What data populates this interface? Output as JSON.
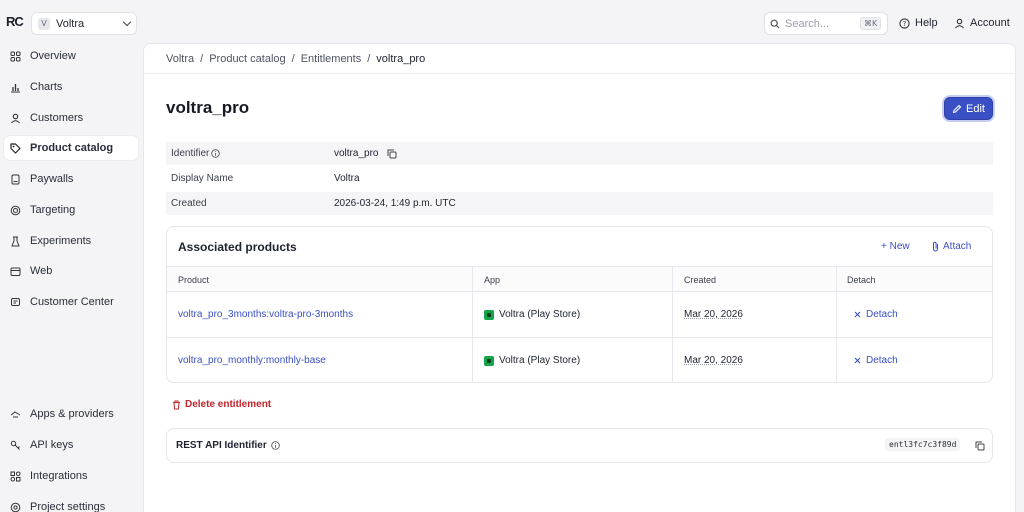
{
  "app": {
    "logo_text": "RC",
    "project_initial": "V",
    "project_name": "Voltra"
  },
  "topbar": {
    "search_placeholder": "Search...",
    "search_shortcut": "⌘K",
    "help_label": "Help",
    "account_label": "Account"
  },
  "sidebar": {
    "items": [
      {
        "label": "Overview",
        "icon": "grid-icon"
      },
      {
        "label": "Charts",
        "icon": "chart-icon"
      },
      {
        "label": "Customers",
        "icon": "user-icon"
      },
      {
        "label": "Product catalog",
        "icon": "tag-icon",
        "active": true
      },
      {
        "label": "Paywalls",
        "icon": "paywall-icon"
      },
      {
        "label": "Targeting",
        "icon": "target-icon"
      },
      {
        "label": "Experiments",
        "icon": "flask-icon"
      },
      {
        "label": "Web",
        "icon": "browser-icon"
      },
      {
        "label": "Customer Center",
        "icon": "support-icon"
      }
    ],
    "bottom_items": [
      {
        "label": "Apps & providers",
        "icon": "apps-icon"
      },
      {
        "label": "API keys",
        "icon": "key-icon"
      },
      {
        "label": "Integrations",
        "icon": "integrations-icon"
      },
      {
        "label": "Project settings",
        "icon": "settings-icon"
      }
    ]
  },
  "breadcrumb": [
    "Voltra",
    "Product catalog",
    "Entitlements",
    "voltra_pro"
  ],
  "breadcrumb_separator": "/",
  "page": {
    "title": "voltra_pro",
    "edit_label": "Edit"
  },
  "details": {
    "identifier_label": "Identifier",
    "identifier_value": "voltra_pro",
    "display_name_label": "Display Name",
    "display_name_value": "Voltra",
    "created_label": "Created",
    "created_value": "2026-03-24, 1:49 p.m. UTC"
  },
  "associated": {
    "title": "Associated products",
    "new_label": "+ New",
    "attach_label": "Attach",
    "columns": [
      "Product",
      "App",
      "Created",
      "Detach"
    ],
    "rows": [
      {
        "product": "voltra_pro_3months:voltra-pro-3months",
        "app": "Voltra (Play Store)",
        "created": "Mar 20, 2026",
        "detach": "Detach"
      },
      {
        "product": "voltra_pro_monthly:monthly-base",
        "app": "Voltra (Play Store)",
        "created": "Mar 20, 2026",
        "detach": "Detach"
      }
    ]
  },
  "delete_label": "Delete entitlement",
  "rest": {
    "label": "REST API Identifier",
    "value": "entl3fc7c3f89d"
  },
  "colors": {
    "accent": "#3b4fc4",
    "danger": "#c0262d",
    "android": "#16a34a"
  }
}
